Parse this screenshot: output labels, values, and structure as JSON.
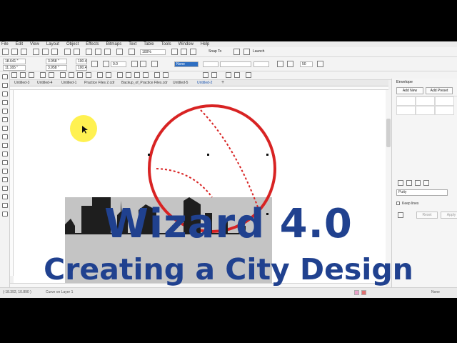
{
  "menubar": {
    "items": [
      "File",
      "Edit",
      "View",
      "Layout",
      "Object",
      "Effects",
      "Bitmaps",
      "Text",
      "Table",
      "Tools",
      "Window",
      "Help"
    ]
  },
  "toolbar": {
    "zoom": "100%",
    "snap": "Snap To",
    "launch": "Launch",
    "x": "18.641 \"",
    "y": "11.165 \"",
    "w": "3.958 \"",
    "h": "3.958 \"",
    "scale_w": "100.4",
    "scale_h": "100.4",
    "angle": "0.0",
    "outline": "None",
    "num": "50"
  },
  "tabs": [
    "Untitled-3",
    "Untitled-4",
    "Untitled-1",
    "Practice Files 2.cdr",
    "Backup_of_Practice Files.cdr",
    "Untitled-5",
    "Untitled-2"
  ],
  "active_tab": "Untitled-2",
  "docker": {
    "title": "Envelope",
    "add_new": "Add New",
    "add_preset": "Add Preset",
    "mode": "Putty",
    "keep_lines": "Keep lines",
    "reset": "Reset",
    "apply": "Apply"
  },
  "status": {
    "coords": "(-18.392, 10.890 )",
    "layer": "Curve on Layer 1",
    "fill_right": "None"
  },
  "overlay": {
    "title_line1": "Wizard 4.0",
    "title_line2": "Creating a City Design"
  },
  "colors": {
    "title": "#20418f",
    "skyline": "#1e1e1e",
    "skyline_shadow": "#c4c4c4",
    "baseball_stitch": "#d82323"
  }
}
